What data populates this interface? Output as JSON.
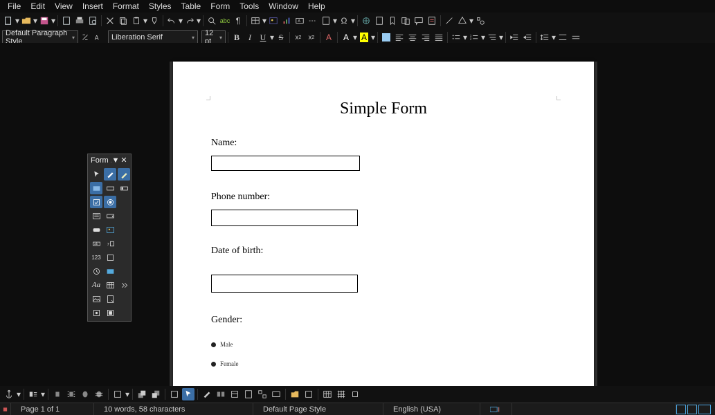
{
  "menu": {
    "file": "File",
    "edit": "Edit",
    "view": "View",
    "insert": "Insert",
    "format": "Format",
    "styles": "Styles",
    "table": "Table",
    "form": "Form",
    "tools": "Tools",
    "window": "Window",
    "help": "Help"
  },
  "format_bar": {
    "para_style": "Default Paragraph Style",
    "font_name": "Liberation Serif",
    "font_size": "12 pt",
    "bold": "B",
    "italic": "I",
    "underline": "U",
    "strike": "S",
    "super": "x²",
    "sub": "x₂"
  },
  "form_palette": {
    "title": "Form ..."
  },
  "doc": {
    "title": "Simple Form",
    "name_label": "Name:",
    "phone_label": "Phone number:",
    "dob_label": "Date of birth:",
    "gender_label": "Gender:",
    "male": "Male",
    "female": "Female"
  },
  "status": {
    "page": "Page 1 of 1",
    "wordcount": "10 words, 58 characters",
    "pagestyle": "Default Page Style",
    "lang": "English (USA)"
  }
}
